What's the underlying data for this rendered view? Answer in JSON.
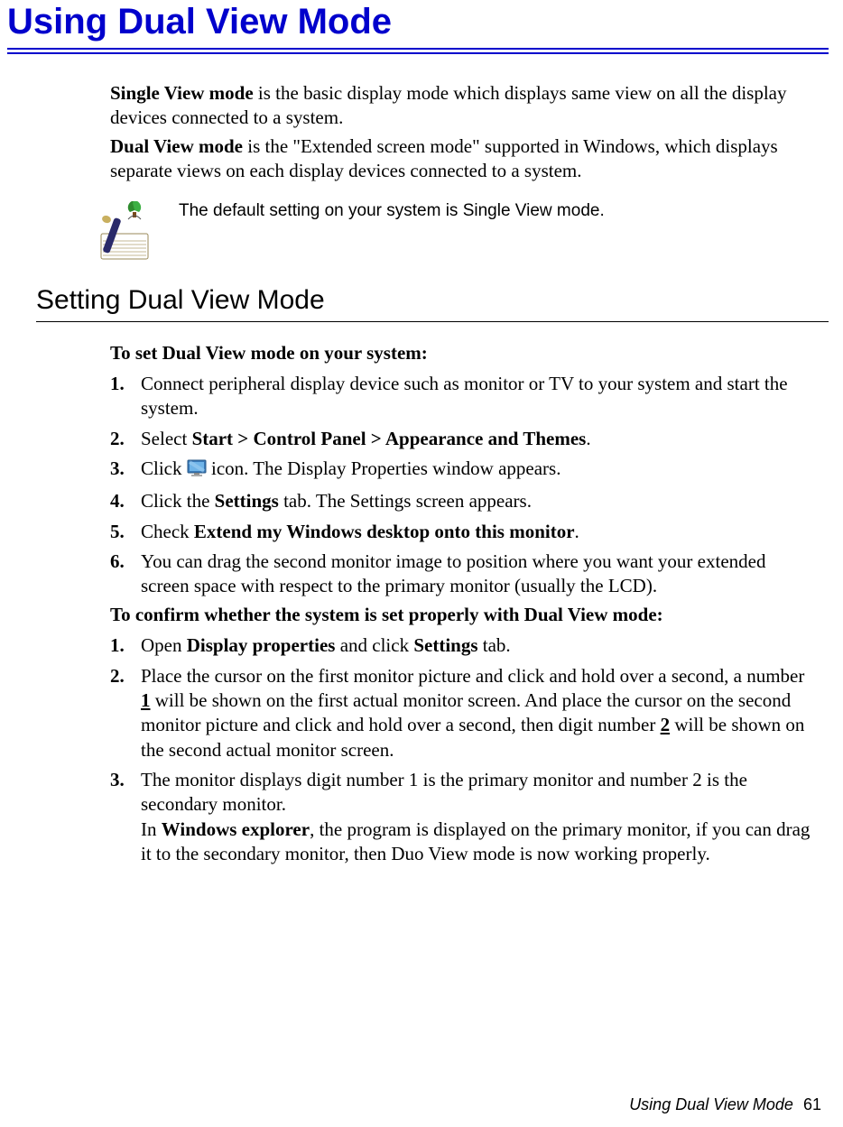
{
  "title": "Using Dual View Mode",
  "intro": {
    "single_label": "Single View mode",
    "single_rest": " is the basic display mode which displays same view on all the display devices connected to a system.",
    "dual_label": "Dual View mode",
    "dual_rest": " is the \"Extended screen mode\" supported in Windows, which displays separate views on each display devices connected to a system."
  },
  "note_text": "The default setting on your system is Single View mode.",
  "h2": "Setting Dual View Mode",
  "lead1": "To set Dual View mode on your system:",
  "steps1": {
    "s1": "Connect peripheral display device such as monitor or TV to your system and start the system.",
    "s2_a": "Select ",
    "s2_b": "Start > Control Panel > Appearance and Themes",
    "s2_c": ".",
    "s3_a": "Click ",
    "s3_b": " icon. The Display Properties window appears.",
    "s4_a": "Click the ",
    "s4_b": "Settings",
    "s4_c": " tab. The Settings screen appears.",
    "s5_a": "Check ",
    "s5_b": "Extend my Windows desktop onto this monitor",
    "s5_c": ".",
    "s6": "You can drag the second monitor image to position where you want your extended screen space with respect to the primary monitor (usually the LCD)."
  },
  "lead2": "To confirm whether the system is set properly with Dual View mode:",
  "steps2": {
    "s1_a": "Open ",
    "s1_b": "Display properties",
    "s1_c": " and click ",
    "s1_d": "Settings",
    "s1_e": " tab.",
    "s2_a": "Place the cursor on the first monitor picture and click and hold over a second, a number ",
    "s2_b": "1",
    "s2_c": " will be shown on the first actual monitor screen. And place the cursor on the second monitor picture and click and hold over a second, then digit number ",
    "s2_d": "2",
    "s2_e": " will be shown on the second actual monitor screen.",
    "s3_a": "The monitor displays digit number 1 is the primary monitor and number 2 is the secondary monitor.",
    "s3_b": "In ",
    "s3_c": "Windows explorer",
    "s3_d": ", the program is displayed on the primary monitor, if you can drag it to the secondary monitor, then Duo View mode is now working properly."
  },
  "footer_label": "Using Dual View Mode",
  "footer_page": "61"
}
